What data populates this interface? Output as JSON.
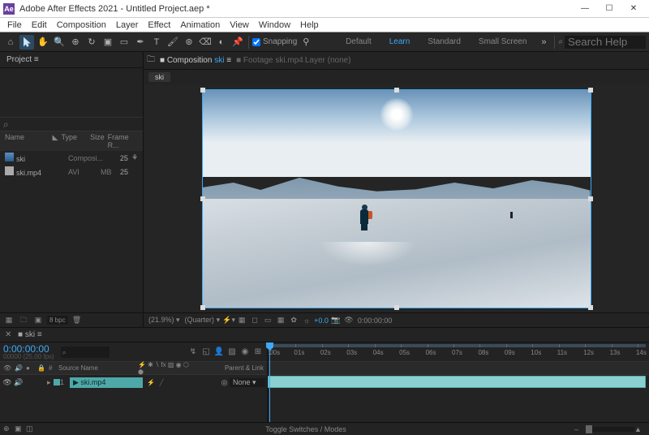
{
  "titlebar": {
    "app": "Adobe After Effects 2021",
    "project": "Untitled Project.aep *"
  },
  "menus": [
    "File",
    "Edit",
    "Composition",
    "Layer",
    "Effect",
    "Animation",
    "View",
    "Window",
    "Help"
  ],
  "toolbar": {
    "snapping": "Snapping",
    "workspaces": [
      "Default",
      "Learn",
      "Standard",
      "Small Screen"
    ],
    "search_placeholder": "Search Help"
  },
  "project": {
    "tab": "Project",
    "columns": [
      "Name",
      "Type",
      "Size",
      "Frame R..."
    ],
    "items": [
      {
        "name": "ski",
        "type": "Composi...",
        "size": "",
        "fr": "25",
        "icon": "comp"
      },
      {
        "name": "ski.mp4",
        "type": "AVI",
        "size": "MB",
        "fr": "25",
        "icon": "file"
      }
    ],
    "bpc": "8 bpc"
  },
  "composition": {
    "tab_label": "Composition",
    "tab_name": "ski",
    "footage_tab": "Footage ski.mp4",
    "layer_tab": "Layer (none)",
    "subtab": "ski",
    "zoom": "(21.9%)",
    "resolution": "(Quarter)",
    "exposure": "+0.0",
    "time": "0:00:00:00"
  },
  "timeline": {
    "tab": "ski",
    "time": "0:00:00:00",
    "time_sub": "00000 (25.00 fps)",
    "cols": {
      "eye": "",
      "source": "Source Name",
      "switches": "",
      "parent": "Parent & Link"
    },
    "ticks": [
      ":00s",
      "01s",
      "02s",
      "03s",
      "04s",
      "05s",
      "06s",
      "07s",
      "08s",
      "09s",
      "10s",
      "11s",
      "12s",
      "13s",
      "14s"
    ],
    "layers": [
      {
        "index": "1",
        "name": "ski.mp4",
        "parent": "None"
      }
    ],
    "toggle": "Toggle Switches / Modes"
  }
}
